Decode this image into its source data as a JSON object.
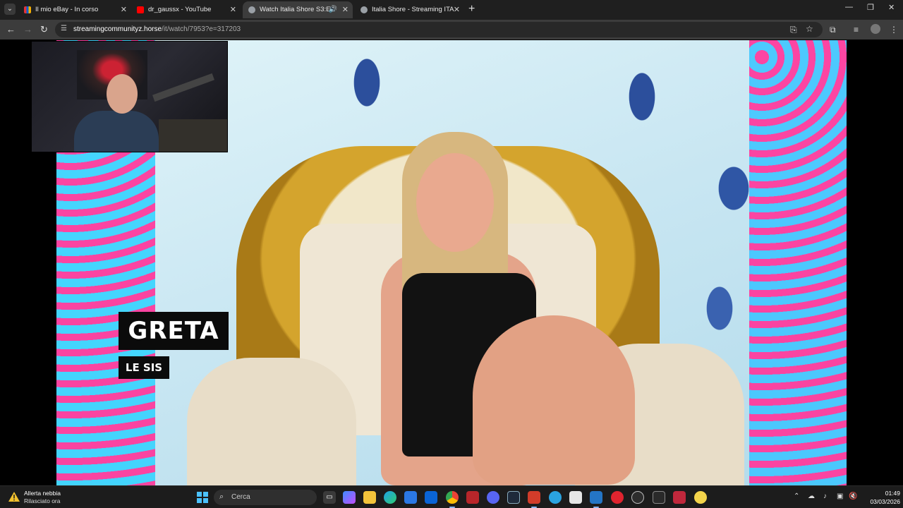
{
  "browser": {
    "tabs": [
      {
        "title": "Il mio eBay - In corso",
        "favicon_color": "#e53238"
      },
      {
        "title": "dr_gaussx - YouTube",
        "favicon_color": "#ff0000"
      },
      {
        "title": "Watch Italia Shore S3:E4",
        "favicon_color": "#9aa0a6",
        "active": true,
        "playing_audio": true
      },
      {
        "title": "Italia Shore - Streaming ITA",
        "favicon_color": "#9aa0a6"
      }
    ],
    "address": {
      "domain": "streamingcommunityz.horse",
      "path": "/it/watch/7953?e=317203"
    }
  },
  "video": {
    "caption_name": "GRETA",
    "caption_tag": "LE SIS"
  },
  "taskbar": {
    "weather_title": "Allerta nebbia",
    "weather_subtitle": "Rilasciato ora",
    "search_placeholder": "Cerca",
    "clock_time": "01:49",
    "clock_date": "03/03/2026"
  }
}
